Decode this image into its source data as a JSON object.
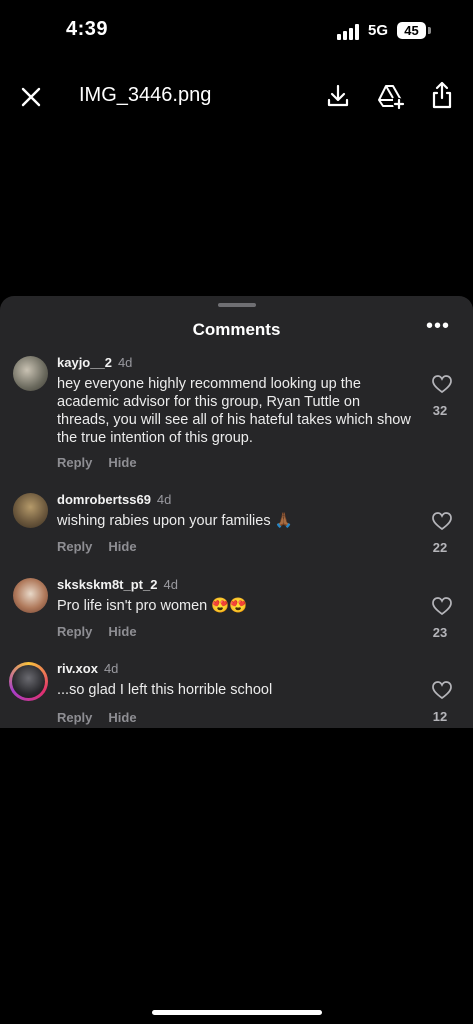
{
  "status_bar": {
    "time": "4:39",
    "network": "5G",
    "battery": "45"
  },
  "top_bar": {
    "title": "IMG_3446.png"
  },
  "sheet": {
    "title": "Comments",
    "more": "•••"
  },
  "comments": [
    {
      "username": "kayjo__2",
      "age": "4d",
      "text": "hey everyone highly recommend looking up the academic advisor for this group, Ryan Tuttle on threads, you will see all of his hateful takes which show the true intention of this group.",
      "reply": "Reply",
      "hide": "Hide",
      "likes": "32"
    },
    {
      "username": "domrobertss69",
      "age": "4d",
      "text": "wishing rabies upon your families 🙏🏾",
      "reply": "Reply",
      "hide": "Hide",
      "likes": "22"
    },
    {
      "username": "skskskm8t_pt_2",
      "age": "4d",
      "text": "Pro life isn't pro women 😍😍",
      "reply": "Reply",
      "hide": "Hide",
      "likes": "23"
    },
    {
      "username": "riv.xox",
      "age": "4d",
      "text": "...so glad I left this horrible school",
      "reply": "Reply",
      "hide": "Hide",
      "likes": "12"
    }
  ],
  "icons": [
    "close-icon",
    "download-icon",
    "drive-add-icon",
    "share-icon",
    "more-icon",
    "heart-icon",
    "signal-icon",
    "battery-icon"
  ]
}
